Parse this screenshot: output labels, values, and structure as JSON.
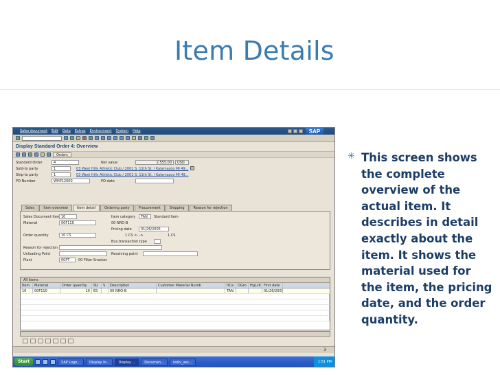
{
  "slide": {
    "title": "Item Details",
    "bullet_text": "This screen shows the complete overview of the actual item.  It describes in detail exactly about the item.  It shows the material used for the item, the pricing date, and the order quantity."
  },
  "sap": {
    "menu": [
      "Sales document",
      "Edit",
      "Goto",
      "Extras",
      "Environment",
      "System",
      "Help"
    ],
    "logo": "SAP",
    "screen_title": "Display Standard Order 4: Overview",
    "orders_button": "Orders",
    "header": {
      "standard_order_label": "Standard Order",
      "standard_order_value": "4",
      "net_value_label": "Net value",
      "net_value": "2,555.00",
      "currency": "USD",
      "sold_to_label": "Sold-to party",
      "sold_to_value": "1",
      "sold_to_desc": "03 West Hills Athletic Club / 2001 S. 11th St. / Kalamazoo MI 49...",
      "ship_to_label": "Ship-to party",
      "ship_to_value": "1",
      "ship_to_desc": "03 West Hills Athletic Club / 2001 S. 11th St. / Kalamazoo MI 49...",
      "po_number_label": "PO Number",
      "po_number_value": "WHP12000",
      "po_date_label": "PO date"
    },
    "tabs": [
      "Sales",
      "Item overview",
      "Item detail",
      "Ordering party",
      "Procurement",
      "Shipping",
      "Reason for rejection"
    ],
    "detail": {
      "sales_doc_item_label": "Sales Document Item",
      "sales_doc_item_value": "10",
      "item_category_label": "Item category",
      "item_category_value": "TAN",
      "item_category_desc": "Standard Item",
      "material_label": "Material",
      "material_value": "00F110",
      "material_desc": "00 NRO-B",
      "pricing_date_label": "Pricing date",
      "pricing_date_value": "01/26/2005",
      "order_qty_label": "Order quantity",
      "order_qty_value": "10 CS",
      "qty_conv": "1 CS  <- ->",
      "qty_conv2": "1 CS",
      "bus_trans_label": "Bus.transaction type",
      "reason_rejection_label": "Reason for rejection",
      "unloading_point_label": "Unloading Point",
      "receiving_point_label": "Receiving point",
      "plant_label": "Plant",
      "plant_value": "00PT",
      "plant_desc": "00 Filter Snacker"
    },
    "grid": {
      "title": "All items",
      "headers": [
        "Item",
        "Material",
        "Order quantity",
        "SU",
        "S",
        "Description",
        "Customer Material Numb",
        "ItCa",
        "DGro",
        "HgLvlt",
        "First date"
      ],
      "rows": [
        [
          "10",
          "00F110",
          "10",
          "ES",
          "",
          "00 NRO-B",
          "",
          "TAN",
          "",
          "",
          "01/26/2005"
        ]
      ]
    },
    "status_page": "3",
    "taskbar": {
      "start": "Start",
      "tasks": [
        "SAP Logo...",
        "Display In...",
        "Display ...",
        "Documen...",
        "indiv_ass..."
      ],
      "time": "1:51 PM"
    }
  }
}
